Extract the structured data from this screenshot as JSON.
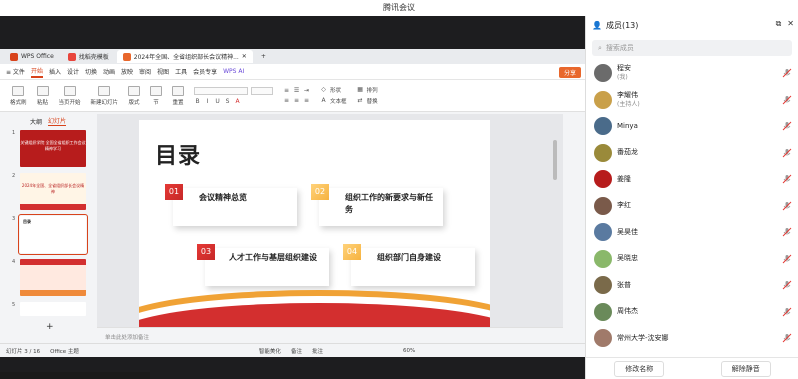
{
  "window": {
    "title": "腾讯会议"
  },
  "wps": {
    "tabs": [
      {
        "label": "WPS Office",
        "color": "#d8431b"
      },
      {
        "label": "找稻壳模板",
        "color": "#e8453c"
      },
      {
        "label": "2024年全国、全省组织部长会议精神...",
        "color": "#e8672c"
      }
    ],
    "menu": {
      "file": "≡ 文件",
      "items": [
        "开始",
        "插入",
        "设计",
        "切换",
        "动画",
        "放映",
        "审阅",
        "视图",
        "工具",
        "会员专享"
      ],
      "wps_ai": "WPS AI",
      "share": "分享"
    },
    "ribbon": {
      "format_painter": "格式刷",
      "paste": "粘贴",
      "from_current": "当页开始",
      "new_slide": "新建幻灯片",
      "layout": "版式",
      "section": "节",
      "reset": "重置",
      "shape": "形状",
      "text_box": "文本框",
      "arrange": "排列",
      "replace": "替换"
    },
    "left_pane": {
      "tab_outline": "大纲",
      "tab_slides": "幻灯片",
      "thumbs": [
        {
          "num": "1",
          "text": "关键组织学院 全国全省组织工作会议精神学习"
        },
        {
          "num": "2",
          "text": "2024年全国、全省组织部长会议精神"
        },
        {
          "num": "3",
          "text": "目录"
        },
        {
          "num": "4",
          "text": ""
        },
        {
          "num": "5",
          "text": ""
        }
      ],
      "add": "+"
    },
    "slide": {
      "title": "目录",
      "items": [
        {
          "num": "01",
          "label": "会议精神总览"
        },
        {
          "num": "02",
          "label": "组织工作的新要求与新任务"
        },
        {
          "num": "03",
          "label": "人才工作与基层组织建设"
        },
        {
          "num": "04",
          "label": "组织部门自身建设"
        }
      ]
    },
    "notes_placeholder": "单击此处添加备注",
    "status": {
      "slide_count": "幻灯片 3 / 16",
      "theme": "Office 主题",
      "smart_beautify": "智能美化",
      "notes": "备注",
      "comments": "批注",
      "zoom": "60%"
    }
  },
  "panel": {
    "title": "成员(13)",
    "search_placeholder": "搜索成员",
    "members": [
      {
        "name": "程安",
        "sub": "(我)",
        "avatar": "#6b6b6b"
      },
      {
        "name": "李耀伟",
        "sub": "(主持人)",
        "avatar": "#c9a04a"
      },
      {
        "name": "Minya",
        "sub": "",
        "avatar": "#4a6b8a"
      },
      {
        "name": "番茄龙",
        "sub": "",
        "avatar": "#9a8a3a"
      },
      {
        "name": "姜隆",
        "sub": "",
        "avatar": "#b71c1c"
      },
      {
        "name": "李红",
        "sub": "",
        "avatar": "#7a5a4a"
      },
      {
        "name": "吴昊佳",
        "sub": "",
        "avatar": "#5a7aa0"
      },
      {
        "name": "吴晓忠",
        "sub": "",
        "avatar": "#8ab86a"
      },
      {
        "name": "张普",
        "sub": "",
        "avatar": "#7a6a4a"
      },
      {
        "name": "周伟杰",
        "sub": "",
        "avatar": "#6a8a5a"
      },
      {
        "name": "常州大学-沈安娜",
        "sub": "",
        "avatar": "#a07a6a"
      }
    ],
    "footer": {
      "rename": "修改名称",
      "unmute_all": "解除静音"
    }
  }
}
